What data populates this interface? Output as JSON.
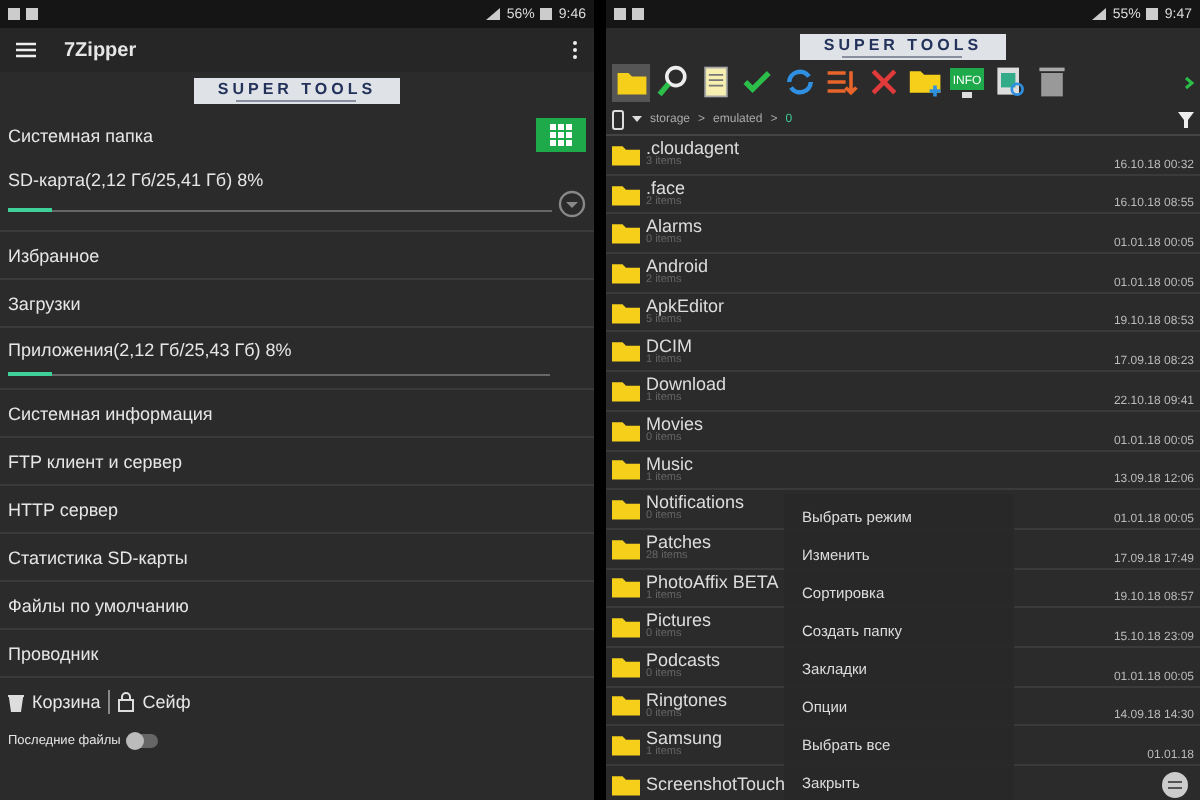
{
  "left": {
    "status_bar": {
      "battery": "56%",
      "time": "9:46"
    },
    "app_bar": {
      "title": "7Zipper"
    },
    "logo": {
      "text": "SUPER TOOLS"
    },
    "items": [
      {
        "kind": "grid",
        "label": "Системная папка"
      },
      {
        "kind": "storage",
        "label": "SD-карта(2,12 Гб/25,41 Гб) 8%",
        "level": 0.08
      },
      {
        "kind": "plain",
        "label": "Избранное"
      },
      {
        "kind": "plain",
        "label": "Загрузки"
      },
      {
        "kind": "storage_small",
        "label": "Приложения(2,12 Гб/25,43 Гб) 8%",
        "level": 0.08
      },
      {
        "kind": "plain",
        "label": "Системная информация"
      },
      {
        "kind": "plain",
        "label": "FTP клиент и сервер"
      },
      {
        "kind": "plain",
        "label": "HTTP сервер"
      },
      {
        "kind": "plain",
        "label": "Статистика SD-карты"
      },
      {
        "kind": "plain",
        "label": "Файлы по умолчанию"
      },
      {
        "kind": "plain",
        "label": "Проводник"
      }
    ],
    "trash": "Корзина",
    "safe": "Сейф",
    "recent": {
      "label": "Последние файлы",
      "on": false
    }
  },
  "right": {
    "status_bar": {
      "battery": "55%",
      "time": "9:47"
    },
    "logo": {
      "text": "SUPER TOOLS"
    },
    "toolbar": {
      "info_label": "INFO"
    },
    "path": [
      "storage",
      "emulated",
      "0"
    ],
    "path_separator": ">",
    "files": [
      {
        "name": ".cloudagent",
        "count": "3 items",
        "date": "16.10.18 00:32"
      },
      {
        "name": ".face",
        "count": "2 items",
        "date": "16.10.18 08:55"
      },
      {
        "name": "Alarms",
        "count": "0 items",
        "date": "01.01.18 00:05"
      },
      {
        "name": "Android",
        "count": "2 items",
        "date": "01.01.18 00:05"
      },
      {
        "name": "ApkEditor",
        "count": "5 items",
        "date": "19.10.18 08:53"
      },
      {
        "name": "DCIM",
        "count": "1 items",
        "date": "17.09.18 08:23"
      },
      {
        "name": "Download",
        "count": "1 items",
        "date": "22.10.18 09:41"
      },
      {
        "name": "Movies",
        "count": "0 items",
        "date": "01.01.18 00:05"
      },
      {
        "name": "Music",
        "count": "1 items",
        "date": "13.09.18 12:06"
      },
      {
        "name": "Notifications",
        "count": "0 items",
        "date": "01.01.18 00:05"
      },
      {
        "name": "Patches",
        "count": "28 items",
        "date": "17.09.18 17:49"
      },
      {
        "name": "PhotoAffix BETA",
        "count": "1 items",
        "date": "19.10.18 08:57"
      },
      {
        "name": "Pictures",
        "count": "0 items",
        "date": "15.10.18 23:09"
      },
      {
        "name": "Podcasts",
        "count": "0 items",
        "date": "01.01.18 00:05"
      },
      {
        "name": "Ringtones",
        "count": "0 items",
        "date": "14.09.18 14:30"
      },
      {
        "name": "Samsung",
        "count": "1 items",
        "date": "01.01.18"
      },
      {
        "name": "ScreenshotTouch"
      }
    ],
    "menu": [
      "Выбрать режим",
      "Изменить",
      "Сортировка",
      "Создать папку",
      "Закладки",
      "Опции",
      "Выбрать все",
      "Закрыть"
    ]
  }
}
